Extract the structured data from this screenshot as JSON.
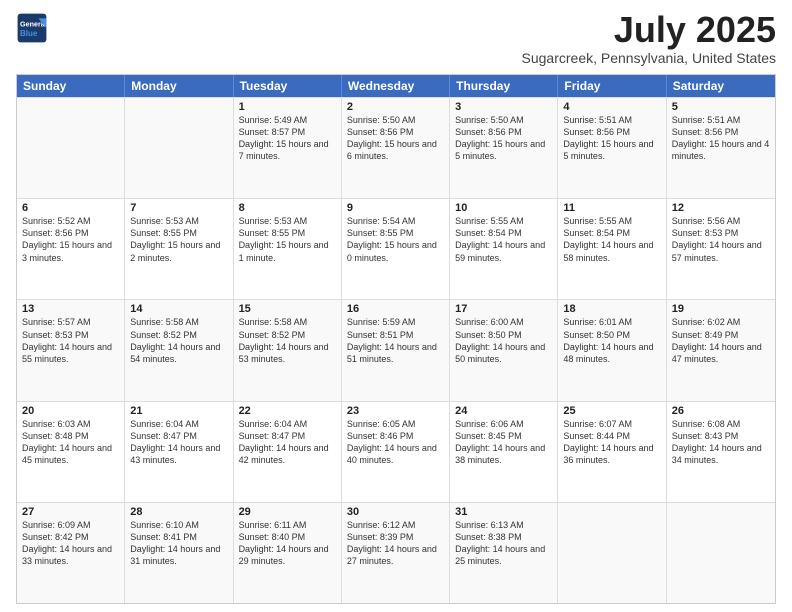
{
  "logo": {
    "line1": "General",
    "line2": "Blue"
  },
  "title": "July 2025",
  "subtitle": "Sugarcreek, Pennsylvania, United States",
  "weekdays": [
    "Sunday",
    "Monday",
    "Tuesday",
    "Wednesday",
    "Thursday",
    "Friday",
    "Saturday"
  ],
  "weeks": [
    [
      {
        "day": "",
        "sunrise": "",
        "sunset": "",
        "daylight": ""
      },
      {
        "day": "",
        "sunrise": "",
        "sunset": "",
        "daylight": ""
      },
      {
        "day": "1",
        "sunrise": "Sunrise: 5:49 AM",
        "sunset": "Sunset: 8:57 PM",
        "daylight": "Daylight: 15 hours and 7 minutes."
      },
      {
        "day": "2",
        "sunrise": "Sunrise: 5:50 AM",
        "sunset": "Sunset: 8:56 PM",
        "daylight": "Daylight: 15 hours and 6 minutes."
      },
      {
        "day": "3",
        "sunrise": "Sunrise: 5:50 AM",
        "sunset": "Sunset: 8:56 PM",
        "daylight": "Daylight: 15 hours and 5 minutes."
      },
      {
        "day": "4",
        "sunrise": "Sunrise: 5:51 AM",
        "sunset": "Sunset: 8:56 PM",
        "daylight": "Daylight: 15 hours and 5 minutes."
      },
      {
        "day": "5",
        "sunrise": "Sunrise: 5:51 AM",
        "sunset": "Sunset: 8:56 PM",
        "daylight": "Daylight: 15 hours and 4 minutes."
      }
    ],
    [
      {
        "day": "6",
        "sunrise": "Sunrise: 5:52 AM",
        "sunset": "Sunset: 8:56 PM",
        "daylight": "Daylight: 15 hours and 3 minutes."
      },
      {
        "day": "7",
        "sunrise": "Sunrise: 5:53 AM",
        "sunset": "Sunset: 8:55 PM",
        "daylight": "Daylight: 15 hours and 2 minutes."
      },
      {
        "day": "8",
        "sunrise": "Sunrise: 5:53 AM",
        "sunset": "Sunset: 8:55 PM",
        "daylight": "Daylight: 15 hours and 1 minute."
      },
      {
        "day": "9",
        "sunrise": "Sunrise: 5:54 AM",
        "sunset": "Sunset: 8:55 PM",
        "daylight": "Daylight: 15 hours and 0 minutes."
      },
      {
        "day": "10",
        "sunrise": "Sunrise: 5:55 AM",
        "sunset": "Sunset: 8:54 PM",
        "daylight": "Daylight: 14 hours and 59 minutes."
      },
      {
        "day": "11",
        "sunrise": "Sunrise: 5:55 AM",
        "sunset": "Sunset: 8:54 PM",
        "daylight": "Daylight: 14 hours and 58 minutes."
      },
      {
        "day": "12",
        "sunrise": "Sunrise: 5:56 AM",
        "sunset": "Sunset: 8:53 PM",
        "daylight": "Daylight: 14 hours and 57 minutes."
      }
    ],
    [
      {
        "day": "13",
        "sunrise": "Sunrise: 5:57 AM",
        "sunset": "Sunset: 8:53 PM",
        "daylight": "Daylight: 14 hours and 55 minutes."
      },
      {
        "day": "14",
        "sunrise": "Sunrise: 5:58 AM",
        "sunset": "Sunset: 8:52 PM",
        "daylight": "Daylight: 14 hours and 54 minutes."
      },
      {
        "day": "15",
        "sunrise": "Sunrise: 5:58 AM",
        "sunset": "Sunset: 8:52 PM",
        "daylight": "Daylight: 14 hours and 53 minutes."
      },
      {
        "day": "16",
        "sunrise": "Sunrise: 5:59 AM",
        "sunset": "Sunset: 8:51 PM",
        "daylight": "Daylight: 14 hours and 51 minutes."
      },
      {
        "day": "17",
        "sunrise": "Sunrise: 6:00 AM",
        "sunset": "Sunset: 8:50 PM",
        "daylight": "Daylight: 14 hours and 50 minutes."
      },
      {
        "day": "18",
        "sunrise": "Sunrise: 6:01 AM",
        "sunset": "Sunset: 8:50 PM",
        "daylight": "Daylight: 14 hours and 48 minutes."
      },
      {
        "day": "19",
        "sunrise": "Sunrise: 6:02 AM",
        "sunset": "Sunset: 8:49 PM",
        "daylight": "Daylight: 14 hours and 47 minutes."
      }
    ],
    [
      {
        "day": "20",
        "sunrise": "Sunrise: 6:03 AM",
        "sunset": "Sunset: 8:48 PM",
        "daylight": "Daylight: 14 hours and 45 minutes."
      },
      {
        "day": "21",
        "sunrise": "Sunrise: 6:04 AM",
        "sunset": "Sunset: 8:47 PM",
        "daylight": "Daylight: 14 hours and 43 minutes."
      },
      {
        "day": "22",
        "sunrise": "Sunrise: 6:04 AM",
        "sunset": "Sunset: 8:47 PM",
        "daylight": "Daylight: 14 hours and 42 minutes."
      },
      {
        "day": "23",
        "sunrise": "Sunrise: 6:05 AM",
        "sunset": "Sunset: 8:46 PM",
        "daylight": "Daylight: 14 hours and 40 minutes."
      },
      {
        "day": "24",
        "sunrise": "Sunrise: 6:06 AM",
        "sunset": "Sunset: 8:45 PM",
        "daylight": "Daylight: 14 hours and 38 minutes."
      },
      {
        "day": "25",
        "sunrise": "Sunrise: 6:07 AM",
        "sunset": "Sunset: 8:44 PM",
        "daylight": "Daylight: 14 hours and 36 minutes."
      },
      {
        "day": "26",
        "sunrise": "Sunrise: 6:08 AM",
        "sunset": "Sunset: 8:43 PM",
        "daylight": "Daylight: 14 hours and 34 minutes."
      }
    ],
    [
      {
        "day": "27",
        "sunrise": "Sunrise: 6:09 AM",
        "sunset": "Sunset: 8:42 PM",
        "daylight": "Daylight: 14 hours and 33 minutes."
      },
      {
        "day": "28",
        "sunrise": "Sunrise: 6:10 AM",
        "sunset": "Sunset: 8:41 PM",
        "daylight": "Daylight: 14 hours and 31 minutes."
      },
      {
        "day": "29",
        "sunrise": "Sunrise: 6:11 AM",
        "sunset": "Sunset: 8:40 PM",
        "daylight": "Daylight: 14 hours and 29 minutes."
      },
      {
        "day": "30",
        "sunrise": "Sunrise: 6:12 AM",
        "sunset": "Sunset: 8:39 PM",
        "daylight": "Daylight: 14 hours and 27 minutes."
      },
      {
        "day": "31",
        "sunrise": "Sunrise: 6:13 AM",
        "sunset": "Sunset: 8:38 PM",
        "daylight": "Daylight: 14 hours and 25 minutes."
      },
      {
        "day": "",
        "sunrise": "",
        "sunset": "",
        "daylight": ""
      },
      {
        "day": "",
        "sunrise": "",
        "sunset": "",
        "daylight": ""
      }
    ]
  ]
}
